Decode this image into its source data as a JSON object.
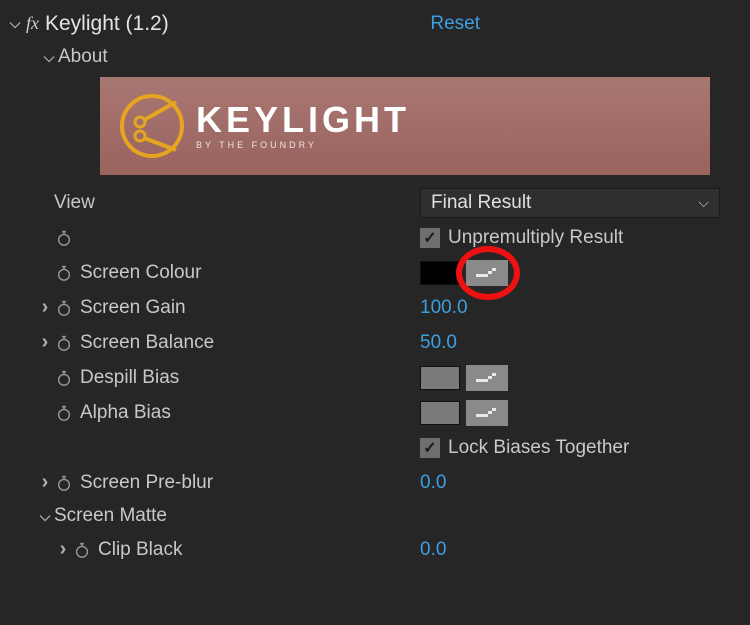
{
  "header": {
    "fx_badge": "fx",
    "title": "Keylight (1.2)",
    "reset": "Reset"
  },
  "about": {
    "label": "About",
    "logo_word": "KEYLIGHT",
    "logo_sub": "BY THE FOUNDRY"
  },
  "props": {
    "view_label": "View",
    "view_value": "Final Result",
    "unpremult_label": "Unpremultiply Result",
    "screen_colour_label": "Screen Colour",
    "screen_gain_label": "Screen Gain",
    "screen_gain_value": "100.0",
    "screen_balance_label": "Screen Balance",
    "screen_balance_value": "50.0",
    "despill_bias_label": "Despill Bias",
    "alpha_bias_label": "Alpha Bias",
    "lock_biases_label": "Lock Biases Together",
    "screen_preblur_label": "Screen Pre-blur",
    "screen_preblur_value": "0.0",
    "screen_matte_label": "Screen Matte",
    "clip_black_label": "Clip Black",
    "clip_black_value": "0.0"
  }
}
